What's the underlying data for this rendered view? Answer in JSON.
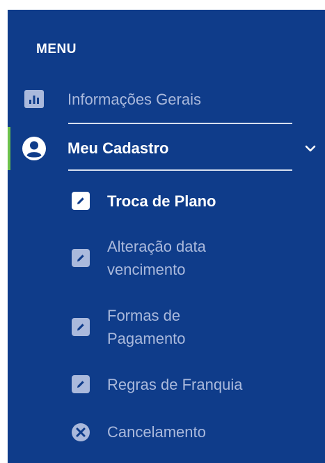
{
  "menu": {
    "title": "MENU",
    "items": [
      {
        "label": "Informações Gerais",
        "icon": "bar-chart-icon",
        "state": "inactive"
      },
      {
        "label": "Meu Cadastro",
        "icon": "user-circle-icon",
        "state": "expanded",
        "expand_icon": "chevron-down-icon"
      }
    ],
    "submenu": [
      {
        "label": "Troca de Plano",
        "icon": "edit-icon",
        "state": "active"
      },
      {
        "label": "Alteração data vencimento",
        "icon": "edit-icon",
        "state": "inactive"
      },
      {
        "label": "Formas de Pagamento",
        "icon": "edit-icon",
        "state": "inactive"
      },
      {
        "label": "Regras de Franquia",
        "icon": "edit-icon",
        "state": "inactive"
      },
      {
        "label": "Cancelamento",
        "icon": "close-circle-icon",
        "state": "inactive"
      }
    ]
  },
  "colors": {
    "sidebar_bg": "#0f3c8a",
    "text_active": "#ffffff",
    "text_inactive": "#aab9dc",
    "active_marker": "#6cc24a"
  }
}
